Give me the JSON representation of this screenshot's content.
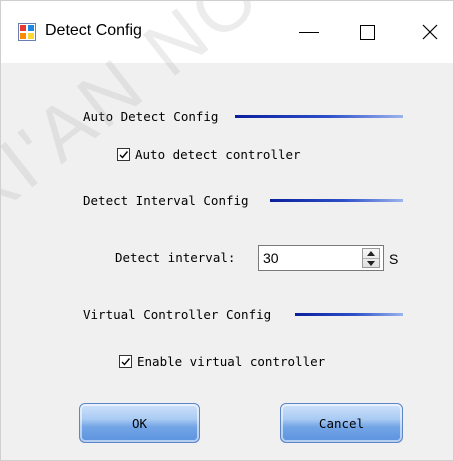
{
  "window": {
    "title": "Detect Config",
    "icon": "app-window-icon",
    "controls": {
      "minimize": "minimize-icon",
      "maximize": "maximize-icon",
      "close": "close-icon"
    }
  },
  "auto_detect": {
    "heading": "Auto Detect Config",
    "checkbox_label": "Auto detect controller",
    "checked": true
  },
  "interval": {
    "heading": "Detect Interval Config",
    "label": "Detect interval:",
    "value": "30",
    "unit": "S"
  },
  "virtual": {
    "heading": "Virtual Controller Config",
    "checkbox_label": "Enable virtual controller",
    "checked": true
  },
  "buttons": {
    "ok": "OK",
    "cancel": "Cancel"
  },
  "watermark": "XI'AN NOVA",
  "colors": {
    "rule_dark": "#0b1f9c",
    "button_blue": "#73a5e6"
  }
}
